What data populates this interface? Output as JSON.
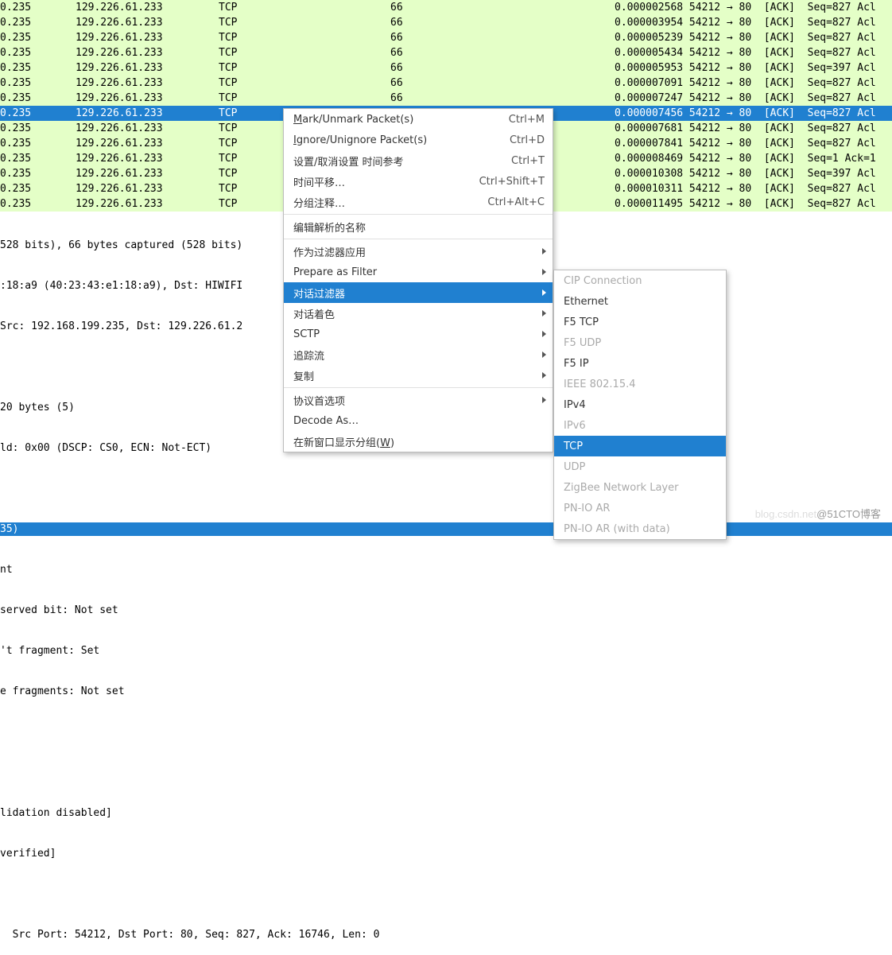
{
  "packets": [
    {
      "src": "0.235",
      "dst": "129.226.61.233",
      "proto": "TCP",
      "len": "66",
      "time": "0.000002568",
      "info": "54212 → 80  [ACK]  Seq=827 Acl",
      "sel": false
    },
    {
      "src": "0.235",
      "dst": "129.226.61.233",
      "proto": "TCP",
      "len": "66",
      "time": "0.000003954",
      "info": "54212 → 80  [ACK]  Seq=827 Acl",
      "sel": false
    },
    {
      "src": "0.235",
      "dst": "129.226.61.233",
      "proto": "TCP",
      "len": "66",
      "time": "0.000005239",
      "info": "54212 → 80  [ACK]  Seq=827 Acl",
      "sel": false
    },
    {
      "src": "0.235",
      "dst": "129.226.61.233",
      "proto": "TCP",
      "len": "66",
      "time": "0.000005434",
      "info": "54212 → 80  [ACK]  Seq=827 Acl",
      "sel": false
    },
    {
      "src": "0.235",
      "dst": "129.226.61.233",
      "proto": "TCP",
      "len": "66",
      "time": "0.000005953",
      "info": "54212 → 80  [ACK]  Seq=397 Acl",
      "sel": false
    },
    {
      "src": "0.235",
      "dst": "129.226.61.233",
      "proto": "TCP",
      "len": "66",
      "time": "0.000007091",
      "info": "54212 → 80  [ACK]  Seq=827 Acl",
      "sel": false
    },
    {
      "src": "0.235",
      "dst": "129.226.61.233",
      "proto": "TCP",
      "len": "66",
      "time": "0.000007247",
      "info": "54212 → 80  [ACK]  Seq=827 Acl",
      "sel": false
    },
    {
      "src": "0.235",
      "dst": "129.226.61.233",
      "proto": "TCP",
      "len": "",
      "time": "0.000007456",
      "info": "54212 → 80  [ACK]  Seq=827 Acl",
      "sel": true
    },
    {
      "src": "0.235",
      "dst": "129.226.61.233",
      "proto": "TCP",
      "len": "66",
      "time": "0.000007681",
      "info": "54212 → 80  [ACK]  Seq=827 Acl",
      "sel": false
    },
    {
      "src": "0.235",
      "dst": "129.226.61.233",
      "proto": "TCP",
      "len": "66",
      "time": "0.000007841",
      "info": "54212 → 80  [ACK]  Seq=827 Acl",
      "sel": false
    },
    {
      "src": "0.235",
      "dst": "129.226.61.233",
      "proto": "TCP",
      "len": "66",
      "time": "0.000008469",
      "info": "54212 → 80  [ACK]  Seq=1 Ack=1",
      "sel": false
    },
    {
      "src": "0.235",
      "dst": "129.226.61.233",
      "proto": "TCP",
      "len": "66",
      "time": "0.000010308",
      "info": "54212 → 80  [ACK]  Seq=397 Acl",
      "sel": false
    },
    {
      "src": "0.235",
      "dst": "129.226.61.233",
      "proto": "TCP",
      "len": "66",
      "time": "0.000010311",
      "info": "54212 → 80  [ACK]  Seq=827 Acl",
      "sel": false
    },
    {
      "src": "0.235",
      "dst": "129.226.61.233",
      "proto": "TCP",
      "len": "66",
      "time": "0.000011495",
      "info": "54212 → 80  [ACK]  Seq=827 Acl",
      "sel": false
    }
  ],
  "details": {
    "l0": "528 bits), 66 bytes captured (528 bits)",
    "l1": ":18:a9 (40:23:43:e1:18:a9), Dst: HIWIFI",
    "l2": "Src: 192.168.199.235, Dst: 129.226.61.2",
    "l3": "",
    "l4": "20 bytes (5)",
    "l5": "ld: 0x00 (DSCP: CS0, ECN: Not-ECT)",
    "l6": "",
    "l7": "35)",
    "l8": "nt",
    "l9": "served bit: Not set",
    "l10": "'t fragment: Set",
    "l11": "e fragments: Not set",
    "l12": "",
    "l13": "",
    "l14": "lidation disabled]",
    "l15": "verified]",
    "l16": "",
    "l17": "  Src Port: 54212, Dst Port: 80, Seq: 827, Ack: 16746, Len: 0"
  },
  "menu1": {
    "items": [
      {
        "label": "Mark/Unmark Packet(s)",
        "accel": "Ctrl+M",
        "u": 0
      },
      {
        "label": "Ignore/Unignore Packet(s)",
        "accel": "Ctrl+D",
        "u": 0
      },
      {
        "label": "设置/取消设置 时间参考",
        "accel": "Ctrl+T"
      },
      {
        "label": "时间平移…",
        "accel": "Ctrl+Shift+T"
      },
      {
        "label": "分组注释…",
        "accel": "Ctrl+Alt+C"
      },
      {
        "sep": true
      },
      {
        "label": "编辑解析的名称"
      },
      {
        "sep": true
      },
      {
        "label": "作为过滤器应用",
        "sub": true
      },
      {
        "label": "Prepare as Filter",
        "sub": true
      },
      {
        "label": "对话过滤器",
        "sub": true,
        "sel": true
      },
      {
        "label": "对话着色",
        "sub": true
      },
      {
        "label": "SCTP",
        "sub": true
      },
      {
        "label": "追踪流",
        "sub": true
      },
      {
        "label": "复制",
        "sub": true
      },
      {
        "sep": true
      },
      {
        "label": "协议首选项",
        "sub": true
      },
      {
        "label": "Decode As…"
      },
      {
        "label": "在新窗口显示分组(W)",
        "u": 9
      }
    ]
  },
  "menu2": {
    "items": [
      {
        "label": "CIP Connection",
        "disabled": true
      },
      {
        "label": "Ethernet"
      },
      {
        "label": "F5 TCP"
      },
      {
        "label": "F5 UDP",
        "disabled": true
      },
      {
        "label": "F5 IP"
      },
      {
        "label": "IEEE 802.15.4",
        "disabled": true
      },
      {
        "label": "IPv4"
      },
      {
        "label": "IPv6",
        "disabled": true
      },
      {
        "label": "TCP",
        "sel": true
      },
      {
        "label": "UDP",
        "disabled": true
      },
      {
        "label": "ZigBee Network Layer",
        "disabled": true
      },
      {
        "label": "PN-IO AR",
        "disabled": true
      },
      {
        "label": "PN-IO AR (with data)",
        "disabled": true
      }
    ]
  },
  "watermark": {
    "wm1": "blog.csdn.net",
    "wm2": "@51CTO博客"
  }
}
